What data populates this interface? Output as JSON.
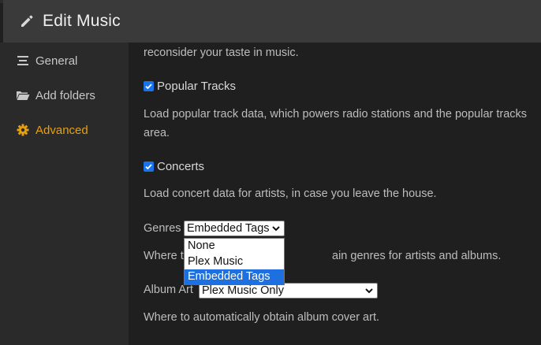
{
  "header": {
    "title": "Edit Music"
  },
  "sidebar": {
    "items": [
      {
        "label": "General",
        "icon": "list-icon"
      },
      {
        "label": "Add folders",
        "icon": "folder-icon"
      },
      {
        "label": "Advanced",
        "icon": "gear-icon",
        "active": true
      }
    ]
  },
  "content": {
    "intro_tail": "reconsider your taste in music.",
    "popular_tracks": {
      "label": "Popular Tracks",
      "checked": true,
      "desc_line1": "Load popular track data, which powers radio stations and the popular tracks",
      "desc_line2": "area."
    },
    "concerts": {
      "label": "Concerts",
      "checked": true,
      "desc": "Load concert data for artists, in case you leave the house."
    },
    "genres": {
      "label": "Genres",
      "value": "Embedded Tags",
      "desc_left": "Where t",
      "desc_right": "ain genres for artists and albums.",
      "options": [
        "None",
        "Plex Music",
        "Embedded Tags"
      ]
    },
    "album_art": {
      "label": "Album Art",
      "value": "Plex Music Only",
      "desc": "Where to automatically obtain album cover art."
    }
  },
  "colors": {
    "accent": "#e5a00d",
    "checkbox": "#1a73e8",
    "selection": "#1e6fe0"
  }
}
